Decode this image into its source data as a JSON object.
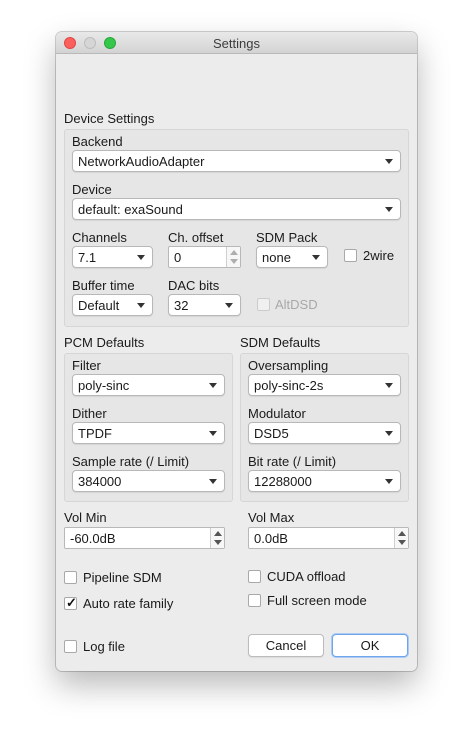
{
  "window": {
    "title": "Settings"
  },
  "device_settings": {
    "heading": "Device Settings",
    "backend": {
      "label": "Backend",
      "value": "NetworkAudioAdapter"
    },
    "device": {
      "label": "Device",
      "value": "default: exaSound"
    },
    "channels": {
      "label": "Channels",
      "value": "7.1"
    },
    "ch_offset": {
      "label": "Ch. offset",
      "value": "0"
    },
    "sdm_pack": {
      "label": "SDM Pack",
      "value": "none"
    },
    "two_wire": {
      "label": "2wire",
      "checked": false
    },
    "buffer_time": {
      "label": "Buffer time",
      "value": "Default"
    },
    "dac_bits": {
      "label": "DAC bits",
      "value": "32"
    },
    "alt_dsd": {
      "label": "AltDSD",
      "checked": false,
      "enabled": false
    }
  },
  "pcm_defaults": {
    "heading": "PCM Defaults",
    "filter": {
      "label": "Filter",
      "value": "poly-sinc"
    },
    "dither": {
      "label": "Dither",
      "value": "TPDF"
    },
    "sample_rate": {
      "label": "Sample rate (/ Limit)",
      "value": "384000"
    }
  },
  "sdm_defaults": {
    "heading": "SDM Defaults",
    "oversampling": {
      "label": "Oversampling",
      "value": "poly-sinc-2s"
    },
    "modulator": {
      "label": "Modulator",
      "value": "DSD5"
    },
    "bit_rate": {
      "label": "Bit rate (/ Limit)",
      "value": "12288000"
    }
  },
  "volume": {
    "min": {
      "label": "Vol Min",
      "value": "-60.0dB"
    },
    "max": {
      "label": "Vol Max",
      "value": "0.0dB"
    }
  },
  "options": {
    "pipeline_sdm": {
      "label": "Pipeline SDM",
      "checked": false
    },
    "cuda_offload": {
      "label": "CUDA offload",
      "checked": false
    },
    "auto_rate_family": {
      "label": "Auto rate family",
      "checked": true
    },
    "full_screen_mode": {
      "label": "Full screen mode",
      "checked": false
    },
    "log_file": {
      "label": "Log file",
      "checked": false
    }
  },
  "buttons": {
    "cancel": "Cancel",
    "ok": "OK"
  },
  "icons": {
    "checkmark": "✓"
  }
}
